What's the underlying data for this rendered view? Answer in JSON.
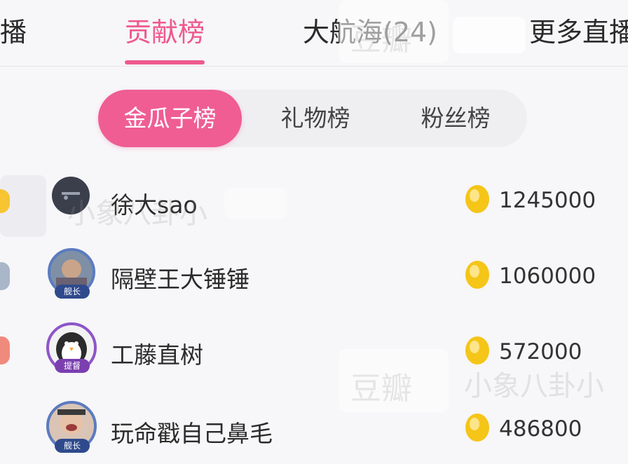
{
  "tabs": [
    {
      "label": "播",
      "active": false
    },
    {
      "label": "贡献榜",
      "active": true
    },
    {
      "label": "大航海(24)",
      "active": false
    },
    {
      "label": "更多直播",
      "active": false
    }
  ],
  "segments": [
    {
      "label": "金瓜子榜",
      "active": true
    },
    {
      "label": "礼物榜",
      "active": false
    },
    {
      "label": "粉丝榜",
      "active": false
    }
  ],
  "rows": [
    {
      "name": "徐大sao",
      "score": "1245000",
      "badge": ""
    },
    {
      "name": "隔壁王大锤锤",
      "score": "1060000",
      "badge": "舰长"
    },
    {
      "name": "工藤直树",
      "score": "572000",
      "badge": "提督"
    },
    {
      "name": "玩命戳自己鼻毛",
      "score": "486800",
      "badge": "舰长"
    }
  ],
  "watermarks": {
    "top": "豆瓣",
    "mid_brand": "豆瓣",
    "mid_text": "小象八卦小",
    "row1_text": "小象八卦小"
  },
  "colors": {
    "accent": "#ee5a8e",
    "coin": "#f5c518"
  }
}
